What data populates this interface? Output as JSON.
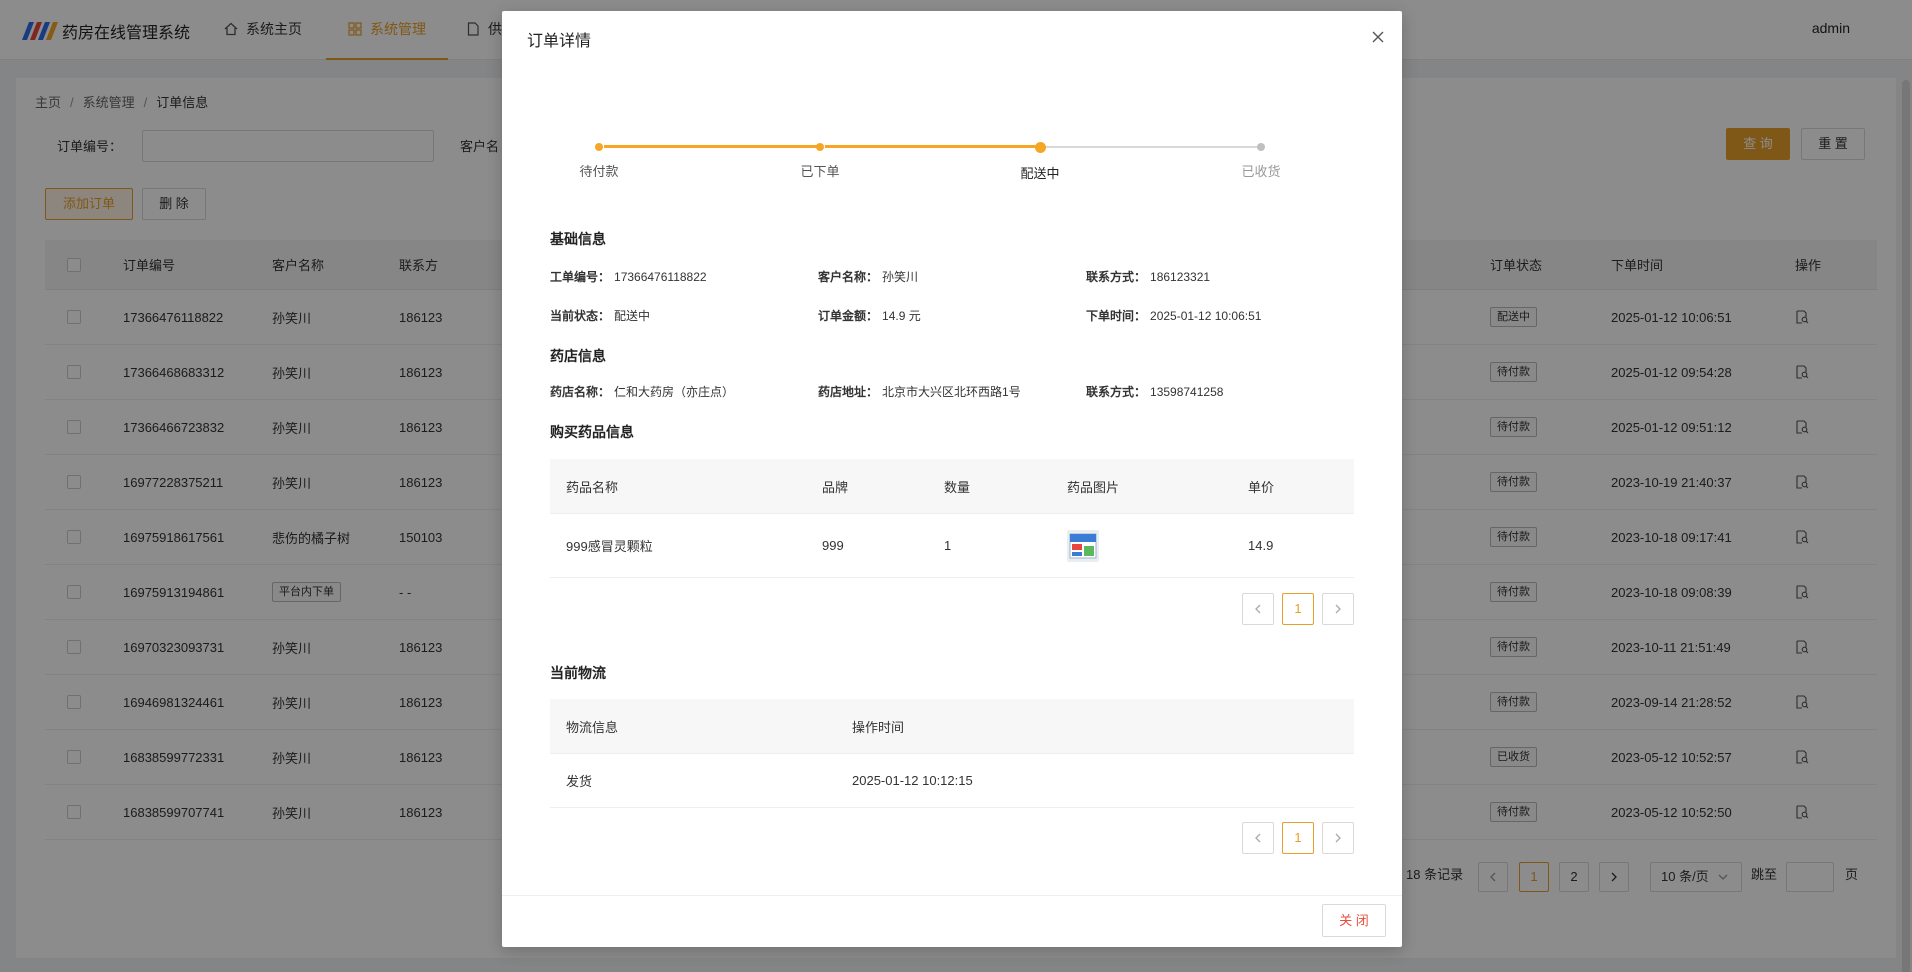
{
  "app": {
    "title": "药房在线管理系统",
    "nav": [
      {
        "label": "系统主页",
        "icon": "home-icon"
      },
      {
        "label": "系统管理",
        "icon": "grid-icon"
      },
      {
        "label": "供",
        "icon": "document-icon"
      }
    ],
    "user": "admin"
  },
  "breadcrumb": [
    "主页",
    "系统管理",
    "订单信息"
  ],
  "search": {
    "order_no_label": "订单编号：",
    "customer_label": "客户名",
    "query_label": "查 询",
    "reset_label": "重 置"
  },
  "toolbar": {
    "add_label": "添加订单",
    "delete_label": "删 除"
  },
  "table": {
    "headers": [
      "订单编号",
      "客户名称",
      "联系方",
      "订单状态",
      "下单时间",
      "操作"
    ],
    "rows": [
      {
        "order_no": "17366476118822",
        "customer": "孙笑川",
        "contact": "186123",
        "status": "配送中",
        "time": "2025-01-12 10:06:51"
      },
      {
        "order_no": "17366468683312",
        "customer": "孙笑川",
        "contact": "186123",
        "status": "待付款",
        "time": "2025-01-12 09:54:28"
      },
      {
        "order_no": "17366466723832",
        "customer": "孙笑川",
        "contact": "186123",
        "status": "待付款",
        "time": "2025-01-12 09:51:12"
      },
      {
        "order_no": "16977228375211",
        "customer": "孙笑川",
        "contact": "186123",
        "status": "待付款",
        "time": "2023-10-19 21:40:37"
      },
      {
        "order_no": "16975918617561",
        "customer": "悲伤的橘子树",
        "contact": "150103",
        "status": "待付款",
        "time": "2023-10-18 09:17:41"
      },
      {
        "order_no": "16975913194861",
        "customer": "平台内下单",
        "contact": "- -",
        "status": "待付款",
        "time": "2023-10-18 09:08:39"
      },
      {
        "order_no": "16970323093731",
        "customer": "孙笑川",
        "contact": "186123",
        "status": "待付款",
        "time": "2023-10-11 21:51:49"
      },
      {
        "order_no": "16946981324461",
        "customer": "孙笑川",
        "contact": "186123",
        "status": "待付款",
        "time": "2023-09-14 21:28:52"
      },
      {
        "order_no": "16838599772331",
        "customer": "孙笑川",
        "contact": "186123",
        "status": "已收货",
        "time": "2023-05-12 10:52:57"
      },
      {
        "order_no": "16838599707741",
        "customer": "孙笑川",
        "contact": "186123",
        "status": "待付款",
        "time": "2023-05-12 10:52:50"
      }
    ]
  },
  "pagination": {
    "total_text": "18 条记录",
    "pages": [
      "1",
      "2"
    ],
    "page_size": "10 条/页",
    "jump_label": "跳至",
    "page_suffix": "页"
  },
  "modal": {
    "title": "订单详情",
    "steps": [
      {
        "label": "待付款"
      },
      {
        "label": "已下单"
      },
      {
        "label": "配送中"
      },
      {
        "label": "已收货"
      }
    ],
    "current_step": 3,
    "colors": {
      "accent": "#f5a623",
      "inactive": "#d9d9d9"
    },
    "basic": {
      "title": "基础信息",
      "order_no_label": "工单编号：",
      "order_no": "17366476118822",
      "customer_label": "客户名称：",
      "customer": "孙笑川",
      "contact_label": "联系方式：",
      "contact": "186123321",
      "status_label": "当前状态：",
      "status": "配送中",
      "amount_label": "订单金额：",
      "amount": "14.9 元",
      "time_label": "下单时间：",
      "time": "2025-01-12 10:06:51"
    },
    "pharmacy": {
      "title": "药店信息",
      "name_label": "药店名称：",
      "name": "仁和大药房（亦庄点）",
      "address_label": "药店地址：",
      "address": "北京市大兴区北环西路1号",
      "contact_label": "联系方式：",
      "contact": "13598741258"
    },
    "drugs": {
      "title": "购买药品信息",
      "headers": [
        "药品名称",
        "品牌",
        "数量",
        "药品图片",
        "单价"
      ],
      "rows": [
        {
          "name": "999感冒灵颗粒",
          "brand": "999",
          "qty": "1",
          "price": "14.9"
        }
      ],
      "page": "1"
    },
    "logistics": {
      "title": "当前物流",
      "headers": [
        "物流信息",
        "操作时间"
      ],
      "rows": [
        {
          "info": "发货",
          "time": "2025-01-12 10:12:15"
        }
      ],
      "page": "1"
    },
    "close_label": "关 闭"
  }
}
